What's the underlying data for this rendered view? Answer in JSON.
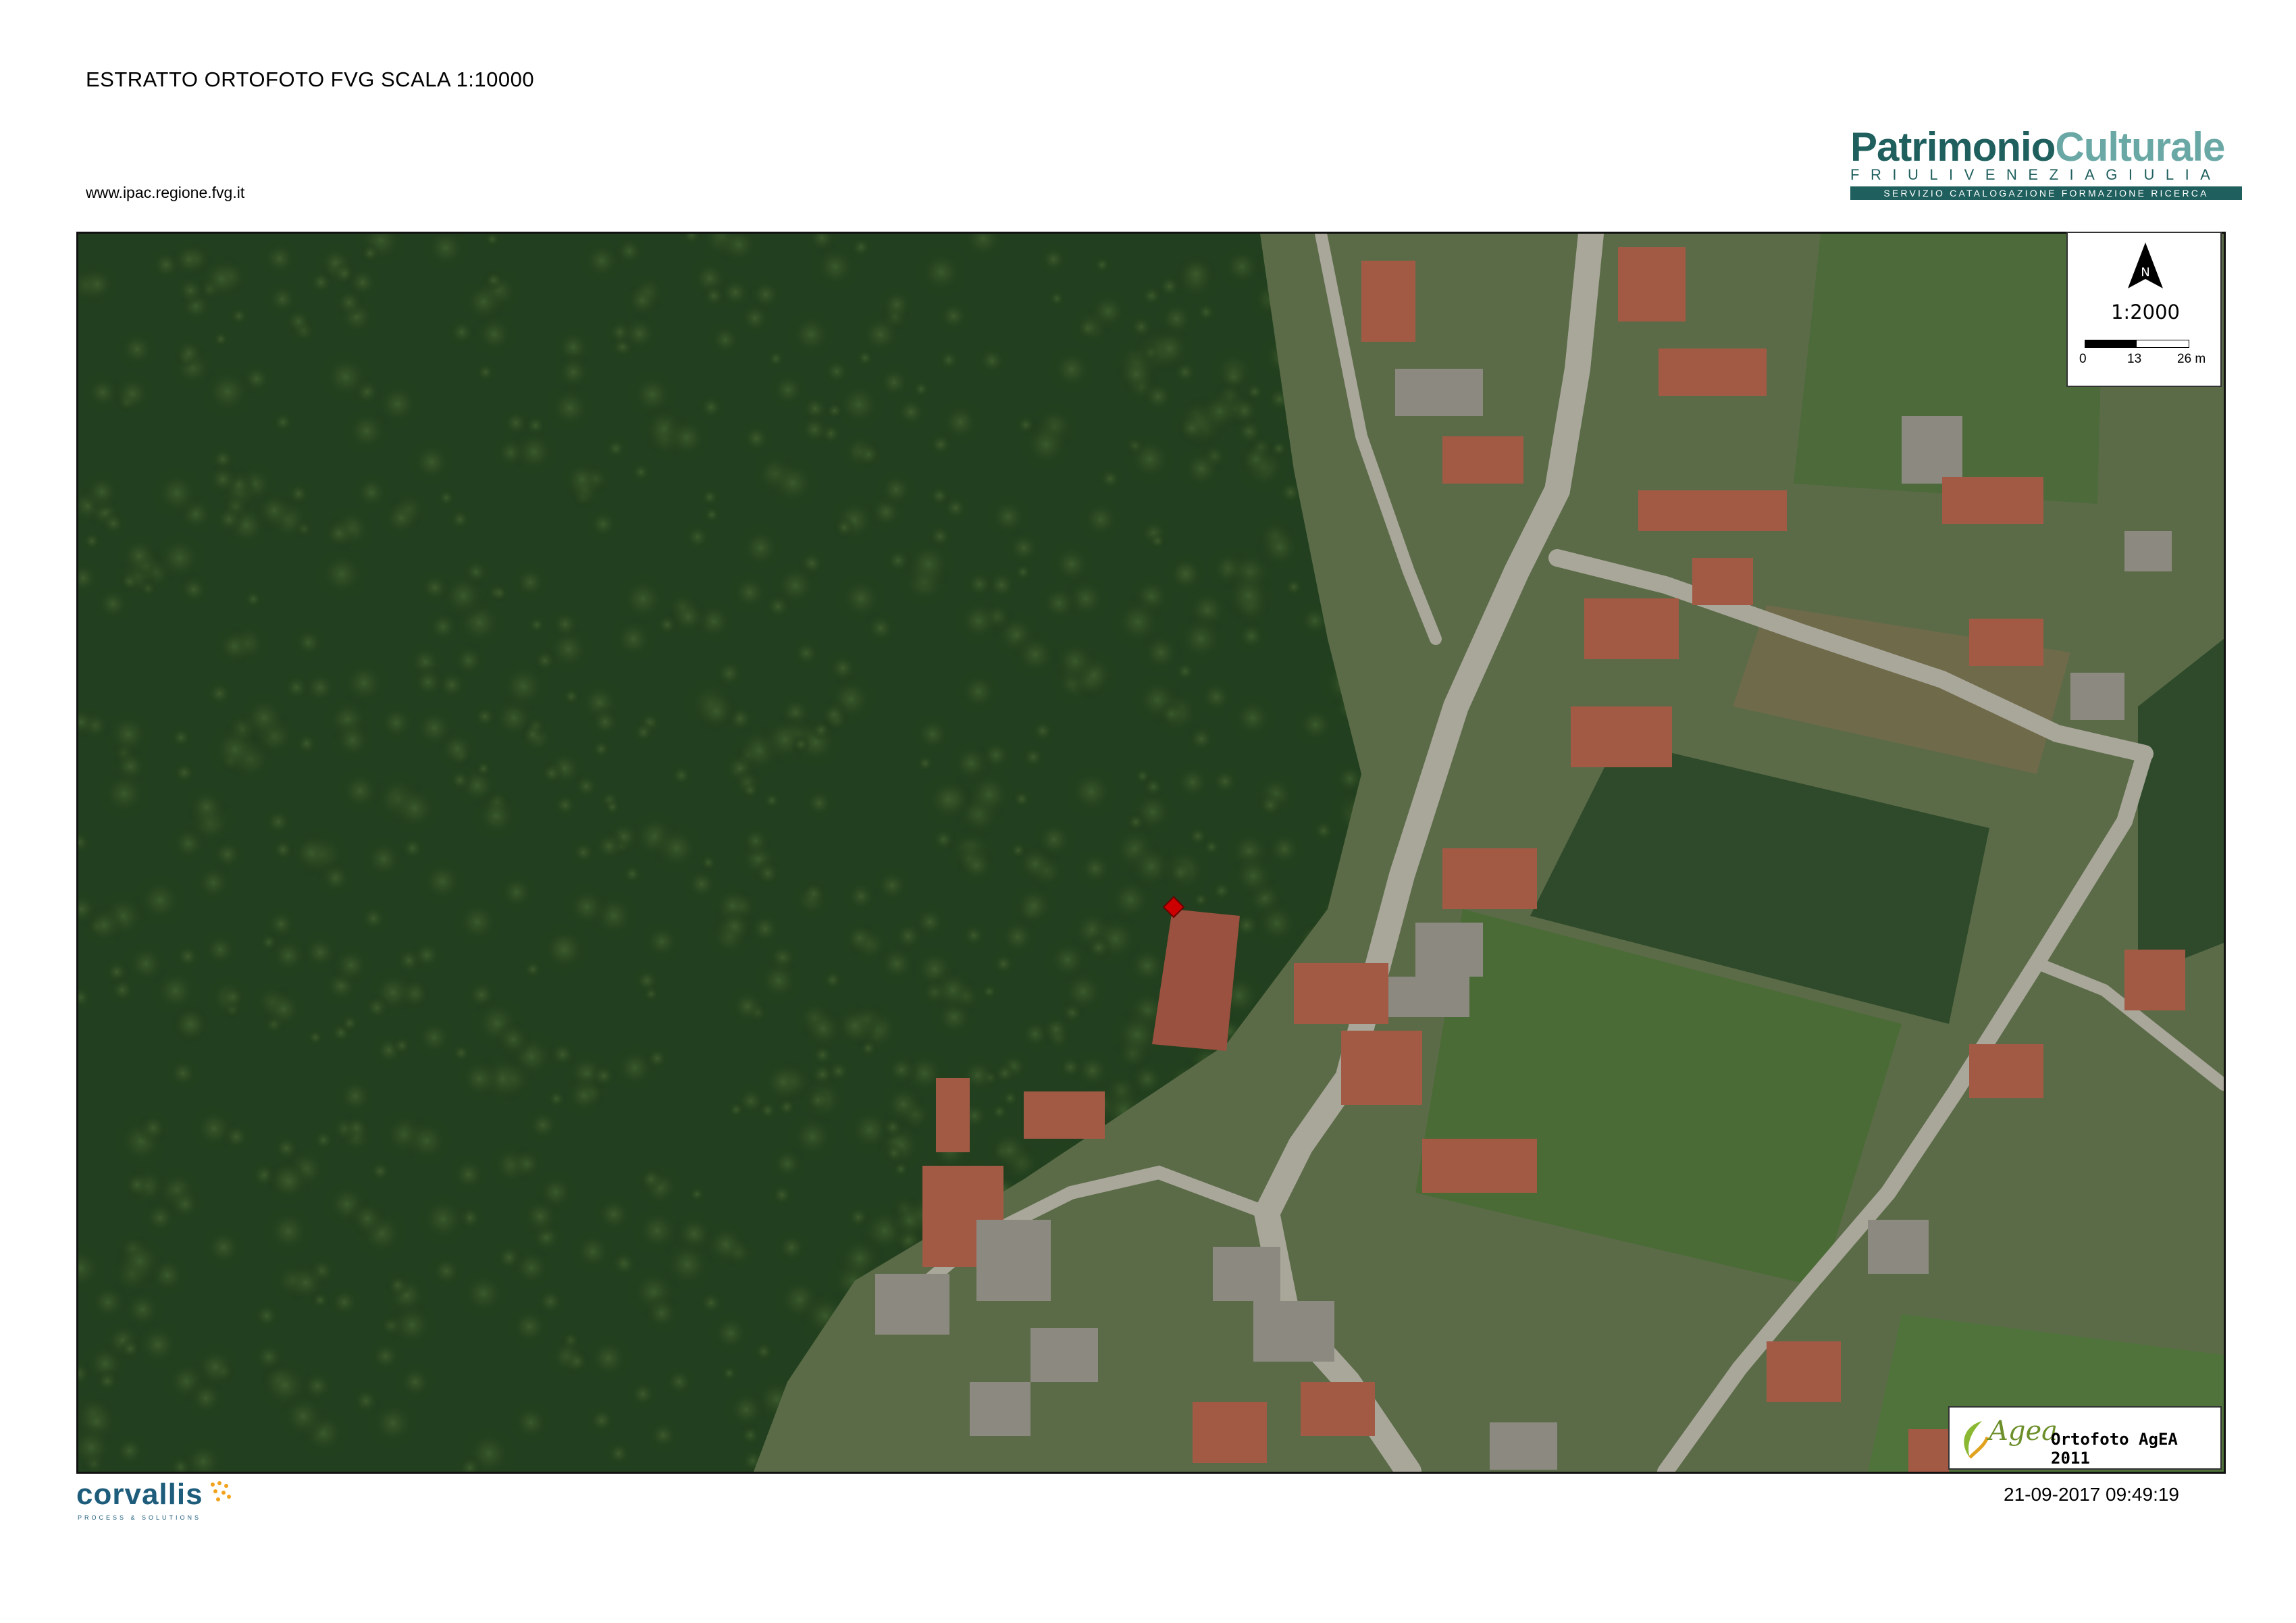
{
  "header": {
    "title": "ESTRATTO ORTOFOTO FVG SCALA 1:10000",
    "url": "www.ipac.regione.fvg.it"
  },
  "logo": {
    "name_part1": "Patrimonio",
    "name_part2": "Culturale",
    "region": "FRIULIVENEZIAGIULIA",
    "service": "SERVIZIO CATALOGAZIONE FORMAZIONE RICERCA",
    "color_dark": "#1f5f5e",
    "color_light": "#6aa8a5"
  },
  "map": {
    "north_label": "N",
    "scale": "1:2000",
    "scalebar_ticks": [
      "0",
      "13",
      "26 m"
    ],
    "marker_color": "#cc0000",
    "attribution_brand": "Agea",
    "attribution_caption": "Ortofoto AgEA 2011"
  },
  "footer": {
    "company": "corvallis",
    "company_tagline": "PROCESS & SOLUTIONS",
    "timestamp": "21-09-2017 09:49:19"
  }
}
